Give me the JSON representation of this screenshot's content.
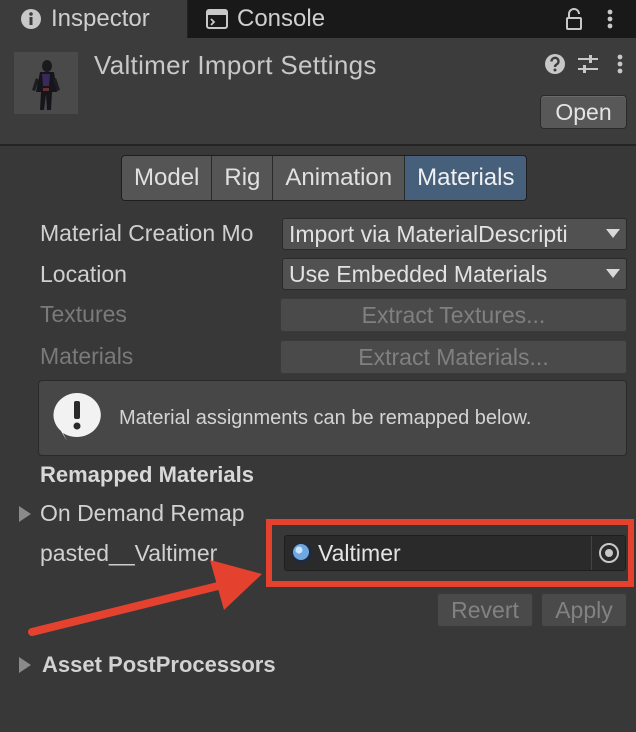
{
  "tabs": {
    "inspector_label": "Inspector",
    "console_label": "Console"
  },
  "header": {
    "title": "Valtimer Import Settings",
    "open_label": "Open"
  },
  "subtabs": [
    {
      "label": "Model",
      "selected": false
    },
    {
      "label": "Rig",
      "selected": false
    },
    {
      "label": "Animation",
      "selected": false
    },
    {
      "label": "Materials",
      "selected": true
    }
  ],
  "material_creation": {
    "label": "Material Creation Mo",
    "value": "Import via MaterialDescripti"
  },
  "location": {
    "label": "Location",
    "value": "Use Embedded Materials"
  },
  "textures": {
    "label": "Textures",
    "button": "Extract Textures..."
  },
  "materials": {
    "label": "Materials",
    "button": "Extract Materials..."
  },
  "helpbox": {
    "text": "Material assignments can be remapped below."
  },
  "remapped": {
    "heading": "Remapped Materials",
    "on_demand_label": "On Demand Remap",
    "slot_label": "pasted__Valtimer",
    "slot_value": "Valtimer"
  },
  "actions": {
    "revert": "Revert",
    "apply": "Apply"
  },
  "postprocessors": {
    "label": "Asset PostProcessors"
  },
  "colors": {
    "selected_tab": "#46607c",
    "highlight": "#e5412f",
    "background": "#383838"
  }
}
